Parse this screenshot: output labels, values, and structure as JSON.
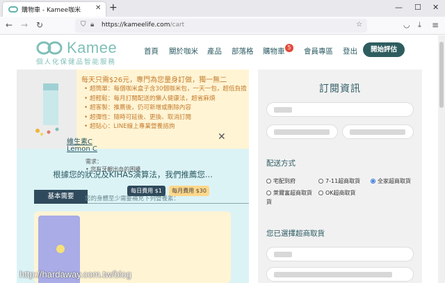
{
  "browser": {
    "tab_title": "購物車 - Kamee咖米",
    "tab_close": "✕",
    "new_tab": "+",
    "url_host": "https://kameelife.com",
    "url_path": "/cart",
    "win_min": "—",
    "win_max": "☐",
    "win_close": "✕",
    "back": "←",
    "forward": "→",
    "reload": "↻",
    "menu": "≡"
  },
  "header": {
    "logo_word": "Kamee",
    "logo_tag": "個人化保健品智能服務",
    "nav": [
      "首頁",
      "關於咖米",
      "產品",
      "部落格",
      "購物車",
      "會員專區",
      "登出"
    ],
    "cart_count": "5",
    "start_button": "開始評估"
  },
  "banner": {
    "title": "每天只需$26元，專門為您量身訂做，獨一無二",
    "points": [
      "超簡單：每個咖米盒子含30個咖米包，一天一包，超低負擔",
      "超輕鬆：每月訂閱配送的懶人健康法，超省麻煩",
      "超客製：推薦後，仍可新增或刪除內容",
      "超彈性：隨時可延後、更換、取消訂閱",
      "超貼心：LINE線上專業營養諮詢"
    ]
  },
  "recommend": {
    "title": "根據您的狀況及KIHAS演算法，我們推薦您...",
    "tab": "基本需要",
    "subtitle": "您的身體至少需要補充下列營養素：",
    "item": {
      "name_zh": "維生素C",
      "name_en": "Lemon C",
      "need_label": "需求：",
      "need_item": "• 您有牙齦出血的困擾",
      "fee_daily": "每日費用 $1",
      "fee_monthly": "每月費用 $30",
      "close": "✕"
    }
  },
  "order": {
    "title": "訂閱資訊",
    "shipping_label": "配送方式",
    "shipping_options": [
      "宅配到府",
      "7-11超商取貨",
      "全家超商取貨",
      "萊爾富超商取貨",
      "OK超商取貨"
    ],
    "shipping_selected": "全家超商取貨",
    "store_label": "您已選擇超商取貨"
  },
  "watermark": "http://hardaway.com.tw/blog",
  "colors": {
    "brand": "#7ebfb8",
    "nav": "#2c5b63",
    "badge": "#e24b3b",
    "banner_bg": "#fff4d4",
    "rec_bg": "#dcf3f6"
  }
}
